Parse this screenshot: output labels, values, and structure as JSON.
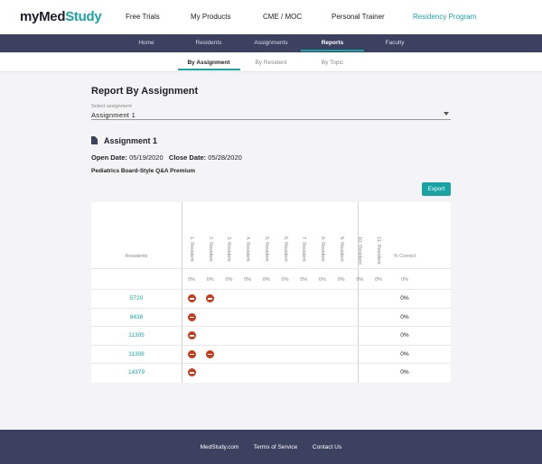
{
  "header": {
    "logo_part1": "myMed",
    "logo_part2": "Study",
    "nav": [
      "Free Trials",
      "My Products",
      "CME / MOC",
      "Personal Trainer",
      "Residency Program"
    ],
    "active_nav_color": "#1aa3a3"
  },
  "main_nav": {
    "items": [
      "Home",
      "Residents",
      "Assignments",
      "Reports",
      "Faculty"
    ],
    "active": "Reports"
  },
  "sub_nav": {
    "items": [
      "By Assignment",
      "By Resident",
      "By Topic"
    ],
    "active": "By Assignment"
  },
  "page": {
    "title": "Report By Assignment",
    "select_label": "Select assignment",
    "select_value": "Assignment 1"
  },
  "assignment": {
    "title": "Assignment 1",
    "open_label": "Open Date:",
    "open_date": "05/19/2020",
    "close_label": "Close Date:",
    "close_date": "05/28/2020",
    "product": "Pediatrics Board-Style Q&A Premium",
    "export_label": "Export"
  },
  "table": {
    "residents_header": "Residents",
    "pct_header": "% Correct",
    "columns": [
      "1. Resident",
      "2. Resident",
      "3. Resident",
      "4. Resident",
      "5. Resident",
      "6. Resident",
      "7. Resident",
      "8. Resident",
      "9. Resident",
      "10. Resident",
      "11. Resident"
    ],
    "column_pct": [
      "0%",
      "0%",
      "0%",
      "0%",
      "0%",
      "0%",
      "0%",
      "0%",
      "0%",
      "0%",
      "0%"
    ],
    "total_pct": "0%",
    "rows": [
      {
        "name": "5720",
        "pct": "0%",
        "marks": [
          0,
          1
        ]
      },
      {
        "name": "8438",
        "pct": "0%",
        "marks": [
          0
        ]
      },
      {
        "name": "11305",
        "pct": "0%",
        "marks": [
          0
        ]
      },
      {
        "name": "11308",
        "pct": "0%",
        "marks": [
          0,
          1
        ]
      },
      {
        "name": "14379",
        "pct": "0%",
        "marks": [
          0
        ]
      }
    ],
    "mark_color": "#c63b1e"
  },
  "footer": {
    "items": [
      "MedStudy.com",
      "Terms of Service",
      "Contact Us"
    ]
  }
}
